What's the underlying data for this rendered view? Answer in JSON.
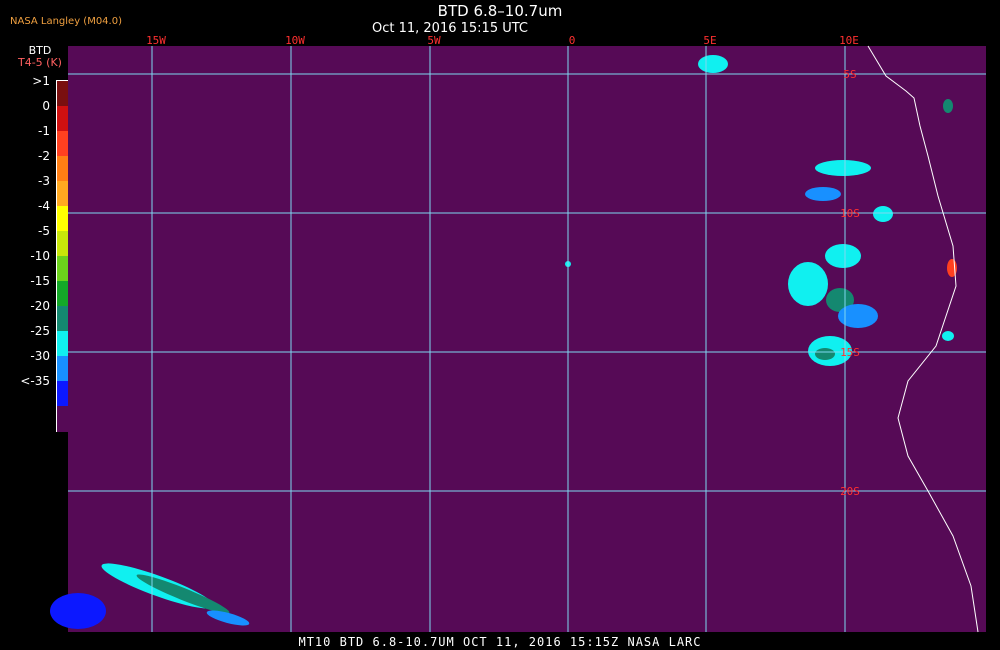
{
  "header": {
    "producer": "NASA Langley (M04.0)",
    "title": "BTD 6.8–10.7um",
    "subtitle": "Oct 11, 2016 15:15 UTC"
  },
  "footer": {
    "caption": "MT10  BTD 6.8-10.7UM   OCT 11, 2016 15:15Z   NASA LARC"
  },
  "legend": {
    "title": "BTD",
    "unit": "T4-5 (K)",
    "ticks": [
      ">1",
      "0",
      "-1",
      "-2",
      "-3",
      "-4",
      "-5",
      "-10",
      "-15",
      "-20",
      "-25",
      "-30",
      "<-35"
    ],
    "colors": [
      "#7a0f0f",
      "#d01010",
      "#ff4020",
      "#ff7e14",
      "#ffa820",
      "#ffff00",
      "#c8e60a",
      "#6cd21c",
      "#14a828",
      "#148870",
      "#10f0f0",
      "#1890ff",
      "#0c18ff",
      "#560a56"
    ]
  },
  "map": {
    "background_color": "#560a56",
    "grid_color": "#7fd8f0",
    "coast_color": "#ffffff",
    "lon_labels": [
      "15W",
      "10W",
      "5W",
      "0",
      "5E",
      "10E"
    ],
    "lat_labels": [
      "5S",
      "10S",
      "15S",
      "20S"
    ]
  }
}
